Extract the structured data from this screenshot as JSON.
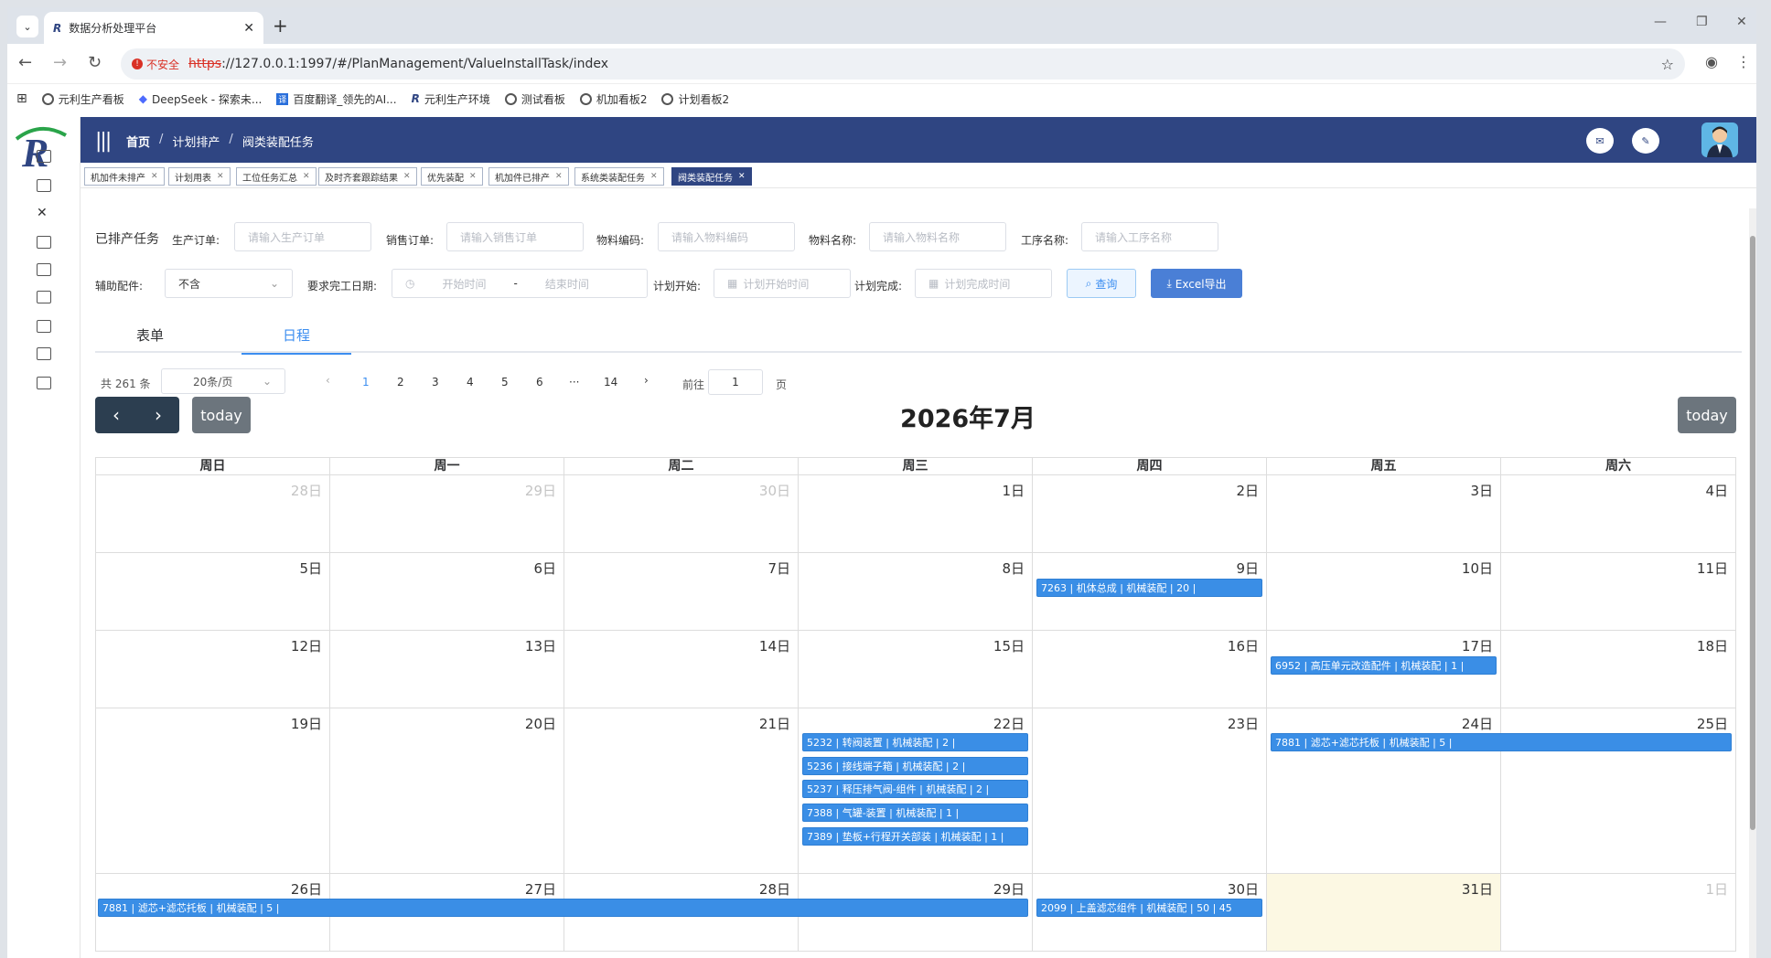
{
  "browser": {
    "tab_title": "数据分析处理平台",
    "insecure_label": "不安全",
    "url_scheme": "https",
    "url_rest": "://127.0.0.1:1997/#/PlanManagement/ValueInstallTask/index",
    "bookmarks": [
      "元利生产看板",
      "DeepSeek - 探索未...",
      "百度翻译_领先的AI...",
      "元利生产环境",
      "测试看板",
      "机加看板2",
      "计划看板2"
    ]
  },
  "header": {
    "breadcrumbs": [
      "首页",
      "计划排产",
      "阀类装配任务"
    ]
  },
  "tags": [
    "机加件未排产",
    "计划用表",
    "工位任务汇总",
    "及时齐套跟踪结果",
    "优先装配",
    "机加件已排产",
    "系统类装配任务",
    "阀类装配任务"
  ],
  "filters": {
    "section_title": "已排产任务",
    "production_order": {
      "label": "生产订单:",
      "placeholder": "请输入生产订单"
    },
    "sales_order": {
      "label": "销售订单:",
      "placeholder": "请输入销售订单"
    },
    "material_code": {
      "label": "物料编码:",
      "placeholder": "请输入物料编码"
    },
    "material_name": {
      "label": "物料名称:",
      "placeholder": "请输入物料名称"
    },
    "process_name": {
      "label": "工序名称:",
      "placeholder": "请输入工序名称"
    },
    "aux_parts": {
      "label": "辅助配件:",
      "value": "不含"
    },
    "due_date": {
      "label": "要求完工日期:",
      "start": "开始时间",
      "dash": "-",
      "end": "结束时间"
    },
    "plan_start": {
      "label": "计划开始:",
      "placeholder": "计划开始时间"
    },
    "plan_end": {
      "label": "计划完成:",
      "placeholder": "计划完成时间"
    },
    "query_btn": "查询",
    "export_btn": "Excel导出"
  },
  "view_tabs": [
    "表单",
    "日程"
  ],
  "pager": {
    "total": "共 261 条",
    "page_size": "20条/页",
    "pages": [
      "1",
      "2",
      "3",
      "4",
      "5",
      "6",
      "···",
      "14"
    ],
    "goto_label": "前往",
    "goto_value": "1",
    "page_unit": "页"
  },
  "calendar": {
    "title": "2026年7月",
    "today_label": "today",
    "weekdays": [
      "周日",
      "周一",
      "周二",
      "周三",
      "周四",
      "周五",
      "周六"
    ],
    "weeks": [
      [
        "28日",
        "29日",
        "30日",
        "1日",
        "2日",
        "3日",
        "4日"
      ],
      [
        "5日",
        "6日",
        "7日",
        "8日",
        "9日",
        "10日",
        "11日"
      ],
      [
        "12日",
        "13日",
        "14日",
        "15日",
        "16日",
        "17日",
        "18日"
      ],
      [
        "19日",
        "20日",
        "21日",
        "22日",
        "23日",
        "24日",
        "25日"
      ],
      [
        "26日",
        "27日",
        "28日",
        "29日",
        "30日",
        "31日",
        "1日"
      ]
    ],
    "events": {
      "e1": "7263 | 机体总成 | 机械装配 | 20 |",
      "e2": "6952 | 高压单元改造配件 | 机械装配 | 1 |",
      "e3": "5232 | 转阀装置 | 机械装配 | 2 |",
      "e4": "5236 | 接线端子箱 | 机械装配 | 2 |",
      "e5": "5237 | 释压排气阀-组件 | 机械装配 | 2 |",
      "e6": "7388 | 气罐-装置 | 机械装配 | 1 |",
      "e7": "7389 | 垫板+行程开关部装 | 机械装配 | 1 |",
      "e8": "7881 | 滤芯+滤芯托板 | 机械装配 | 5 |",
      "e9": "7881 | 滤芯+滤芯托板 | 机械装配 | 5 |",
      "e10": "2099 | 上盖滤芯组件 | 机械装配 | 50 | 45"
    },
    "colors": {
      "event": "#3a8ee6",
      "today_bg": "#fcf8e3",
      "header": "#2f4582"
    }
  }
}
